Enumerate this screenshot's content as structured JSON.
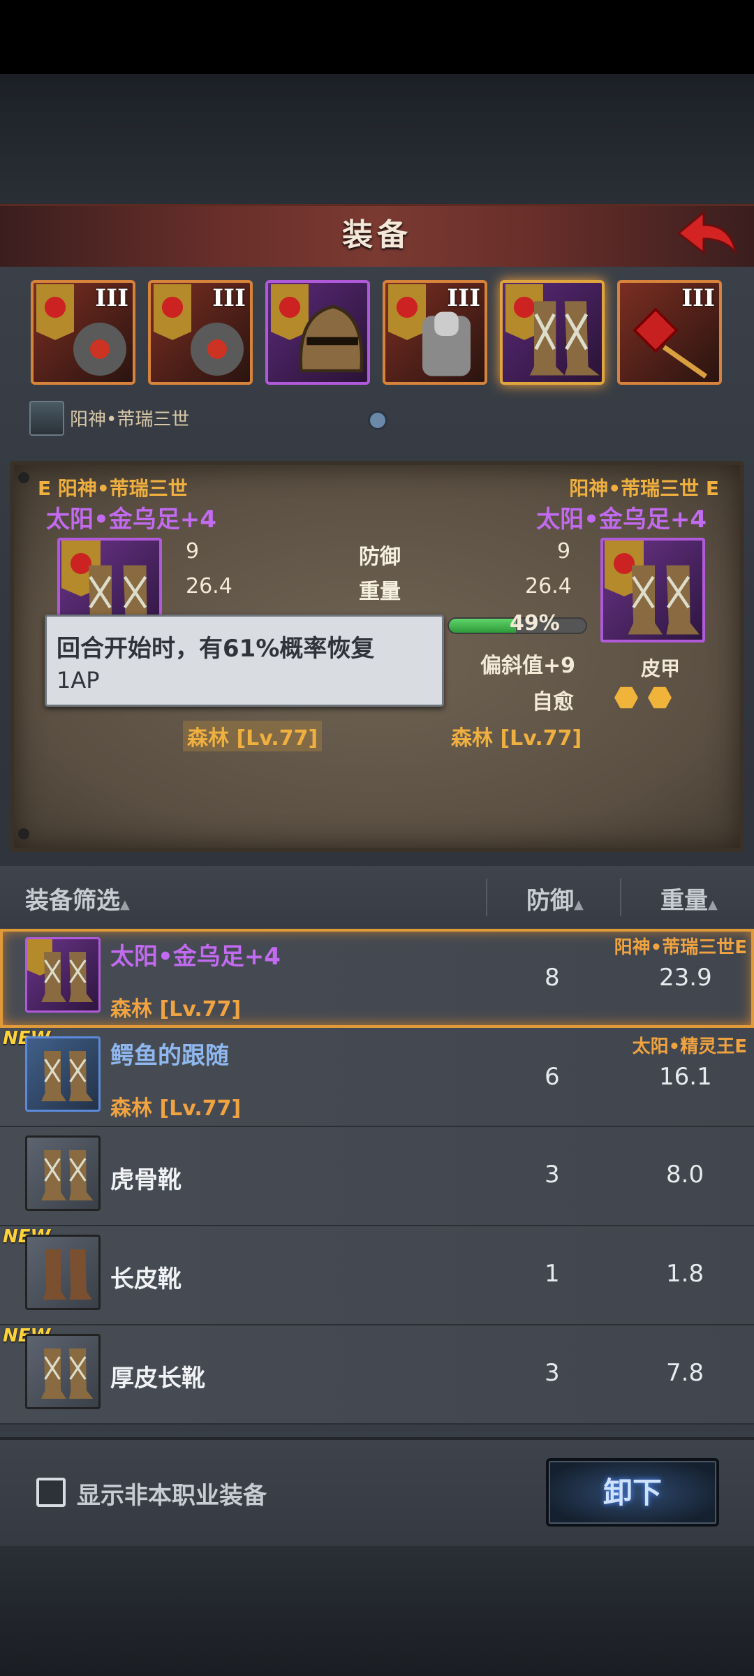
{
  "header": {
    "title": "装备"
  },
  "slots": [
    {
      "tier": "III",
      "rarity": "orange"
    },
    {
      "tier": "III",
      "rarity": "orange"
    },
    {
      "tier": "",
      "rarity": "purple"
    },
    {
      "tier": "III",
      "rarity": "orange"
    },
    {
      "tier": "",
      "rarity": "purple",
      "selected": true
    },
    {
      "tier": "III",
      "rarity": "orange"
    }
  ],
  "character": {
    "name": "阳神•芾瑞三世"
  },
  "compare": {
    "left": {
      "owner": "E 阳神•芾瑞三世",
      "item_name": "太阳•金乌足",
      "plus": "+4",
      "defense": "9",
      "weight": "26.4",
      "location": "森林 [Lv.77]"
    },
    "right": {
      "owner": "阳神•芾瑞三世 E",
      "item_name": "太阳•金乌足",
      "plus": "+4",
      "defense": "9",
      "weight": "26.4",
      "location": "森林 [Lv.77]",
      "progress_text": "49%",
      "progress": 0.49,
      "bonus": "偏斜值+9",
      "skill": "自愈",
      "material": "皮甲"
    },
    "labels": {
      "defense": "防御",
      "weight": "重量"
    },
    "tooltip": {
      "line1": "回合开始时，有61%概率恢复",
      "line2": "1AP"
    }
  },
  "list_header": {
    "filter": "装备筛选",
    "defense": "防御",
    "weight": "重量"
  },
  "items": [
    {
      "badge": "",
      "name": "太阳•金乌足",
      "plus": "+4",
      "loc": "森林 [Lv.77]",
      "owner": "阳神•芾瑞三世E",
      "defense": "8",
      "weight": "23.9"
    },
    {
      "badge": "NEW",
      "name": "鳄鱼的跟随",
      "plus": "",
      "loc": "森林 [Lv.77]",
      "owner": "太阳•精灵王E",
      "defense": "6",
      "weight": "16.1"
    },
    {
      "badge": "",
      "name": "虎骨靴",
      "plus": "",
      "loc": "",
      "owner": "",
      "defense": "3",
      "weight": "8.0"
    },
    {
      "badge": "NEW",
      "name": "长皮靴",
      "plus": "",
      "loc": "",
      "owner": "",
      "defense": "1",
      "weight": "1.8"
    },
    {
      "badge": "NEW",
      "name": "厚皮长靴",
      "plus": "",
      "loc": "",
      "owner": "",
      "defense": "3",
      "weight": "7.8"
    }
  ],
  "footer": {
    "checkbox_label": "显示非本职业装备",
    "unequip": "卸下"
  },
  "colors": {
    "accent_orange": "#f0a340",
    "epic_purple": "#c26af0",
    "rare_blue": "#8fb8f0"
  }
}
